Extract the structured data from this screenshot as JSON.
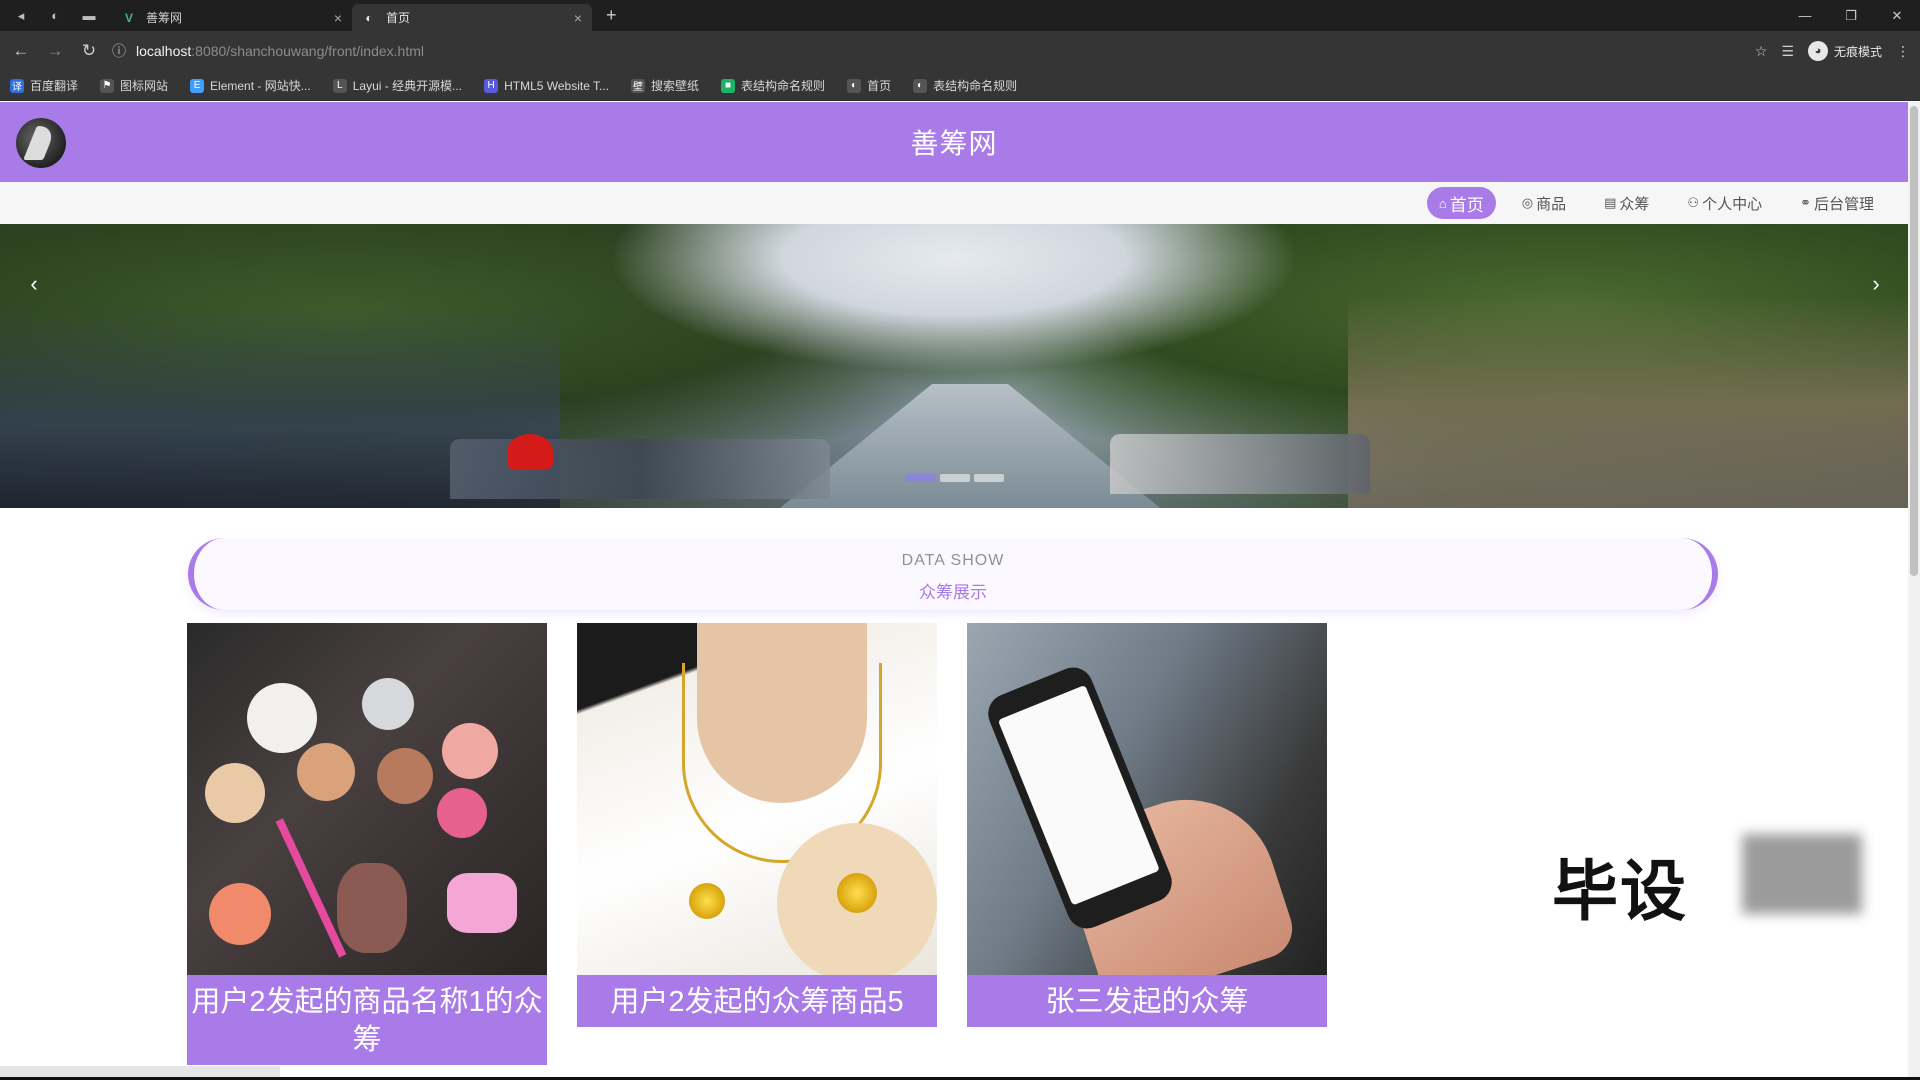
{
  "browser": {
    "tabs": [
      {
        "title": "善筹网",
        "favicon": "vue-logo-icon",
        "active": false
      },
      {
        "title": "首页",
        "favicon": "globe-icon",
        "active": true
      }
    ],
    "close_glyph": "×",
    "newtab_glyph": "+",
    "address": {
      "host": "localhost",
      "path": ":8080/shanchouwang/front/index.html"
    },
    "profile_label": "无痕模式",
    "bookmarks": [
      {
        "label": "百度翻译",
        "icon_color": "#2f6fe0"
      },
      {
        "label": "图标网站",
        "icon_color": "#555555"
      },
      {
        "label": "Element - 网站快...",
        "icon_color": "#409eff"
      },
      {
        "label": "Layui - 经典开源模...",
        "icon_color": "#555555"
      },
      {
        "label": "HTML5 Website T...",
        "icon_color": "#5a5ae0"
      },
      {
        "label": "搜索壁纸",
        "icon_color": "#555555"
      },
      {
        "label": "表结构命名规则",
        "icon_color": "#18b566"
      },
      {
        "label": "首页",
        "icon_color": "#555555"
      },
      {
        "label": "表结构命名规则",
        "icon_color": "#555555"
      }
    ]
  },
  "site": {
    "title": "善筹网",
    "accent_color": "#a97be8",
    "nav": [
      {
        "label": "首页",
        "icon": "home-icon",
        "active": true
      },
      {
        "label": "商品",
        "icon": "goods-icon",
        "active": false
      },
      {
        "label": "众筹",
        "icon": "crowdfund-icon",
        "active": false
      },
      {
        "label": "个人中心",
        "icon": "user-icon",
        "active": false
      },
      {
        "label": "后台管理",
        "icon": "link-icon",
        "active": false
      }
    ],
    "carousel": {
      "slides": 3,
      "active_index": 0
    }
  },
  "section": {
    "title_en": "DATA SHOW",
    "title_cn": "众筹展示"
  },
  "cards": [
    {
      "caption": "用户2发起的商品名称1的众筹",
      "image": "cosmetics"
    },
    {
      "caption": "用户2发起的众筹商品5",
      "image": "necklace"
    },
    {
      "caption": "张三发起的众筹",
      "image": "phone"
    }
  ],
  "watermark": {
    "text": "毕设"
  }
}
